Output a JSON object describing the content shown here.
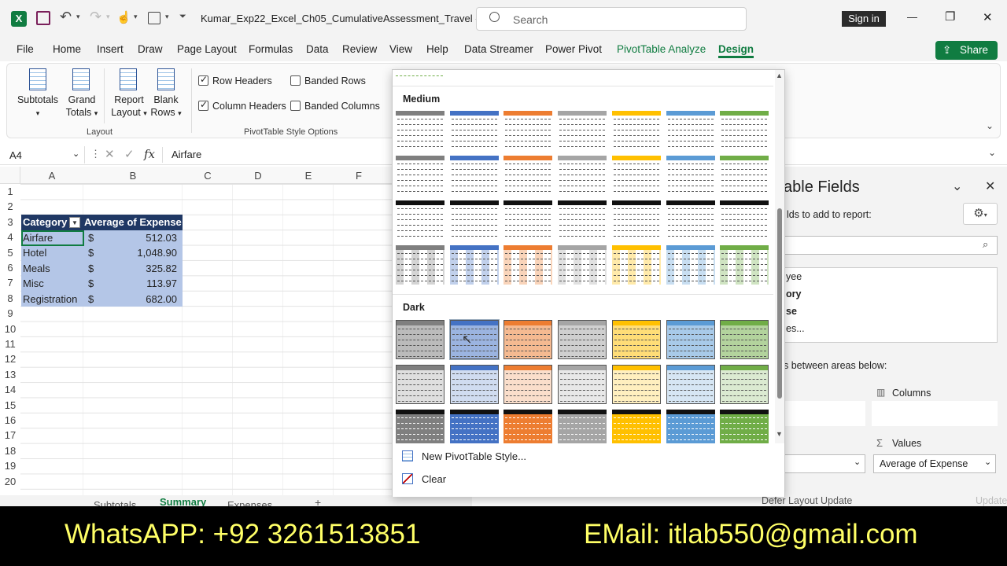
{
  "titlebar": {
    "doc_title": "Kumar_Exp22_Excel_Ch05_CumulativeAssessment_Travel  -...",
    "search_placeholder": "Search",
    "sign_in": "Sign in",
    "minimize": "—",
    "restore": "❐",
    "close": "✕"
  },
  "tabs": [
    "File",
    "Home",
    "Insert",
    "Draw",
    "Page Layout",
    "Formulas",
    "Data",
    "Review",
    "View",
    "Help",
    "Data Streamer",
    "Power Pivot",
    "PivotTable Analyze",
    "Design"
  ],
  "active_tab": "Design",
  "share_label": "Share",
  "ribbon": {
    "layout_buttons": [
      {
        "line1": "Subtotals",
        "line2": ""
      },
      {
        "line1": "Grand",
        "line2": "Totals"
      },
      {
        "line1": "Report",
        "line2": "Layout"
      },
      {
        "line1": "Blank",
        "line2": "Rows"
      }
    ],
    "layout_group": "Layout",
    "options": [
      {
        "label": "Row Headers",
        "checked": true
      },
      {
        "label": "Banded Rows",
        "checked": false
      },
      {
        "label": "Column Headers",
        "checked": true
      },
      {
        "label": "Banded Columns",
        "checked": false
      }
    ],
    "options_group": "PivotTable Style Options"
  },
  "formula": {
    "name_box": "A4",
    "fx": "fx",
    "value": "Airfare"
  },
  "columns": [
    "A",
    "B",
    "C",
    "D",
    "E",
    "F"
  ],
  "rows": [
    "1",
    "2",
    "3",
    "4",
    "5",
    "6",
    "7",
    "8",
    "9",
    "10",
    "11",
    "12",
    "13",
    "14",
    "15",
    "16",
    "17",
    "18",
    "19",
    "20"
  ],
  "pivot": {
    "header": [
      "Category",
      "Average of Expense"
    ],
    "data": [
      {
        "cat": "Airfare",
        "cur": "$",
        "val": "512.03"
      },
      {
        "cat": "Hotel",
        "cur": "$",
        "val": "1,048.90"
      },
      {
        "cat": "Meals",
        "cur": "$",
        "val": "325.82"
      },
      {
        "cat": "Misc",
        "cur": "$",
        "val": "113.97"
      },
      {
        "cat": "Registration",
        "cur": "$",
        "val": "682.00"
      }
    ]
  },
  "sheet_tabs": [
    "Subtotals",
    "Summary",
    "Expenses"
  ],
  "active_sheet": "Summary",
  "gallery": {
    "medium_label": "Medium",
    "dark_label": "Dark",
    "new_style": "New PivotTable Style...",
    "clear": "Clear",
    "colors": [
      "#7f7f7f",
      "#4472c4",
      "#ed7d31",
      "#a5a5a5",
      "#ffc000",
      "#5b9bd5",
      "#70ad47"
    ]
  },
  "pane": {
    "title": "able Fields",
    "subtitle": "lds to add to report:",
    "fields": [
      "yee",
      "ory",
      "se",
      "es..."
    ],
    "drag_text": "s between areas below:",
    "columns_label": "Columns",
    "values_label": "Values",
    "values_item": "Average of Expense",
    "defer": "Defer Layout Update",
    "update": "Update"
  },
  "banner": {
    "whatsapp": "WhatsAPP: +92 3261513851",
    "email": "EMail: itlab550@gmail.com"
  }
}
